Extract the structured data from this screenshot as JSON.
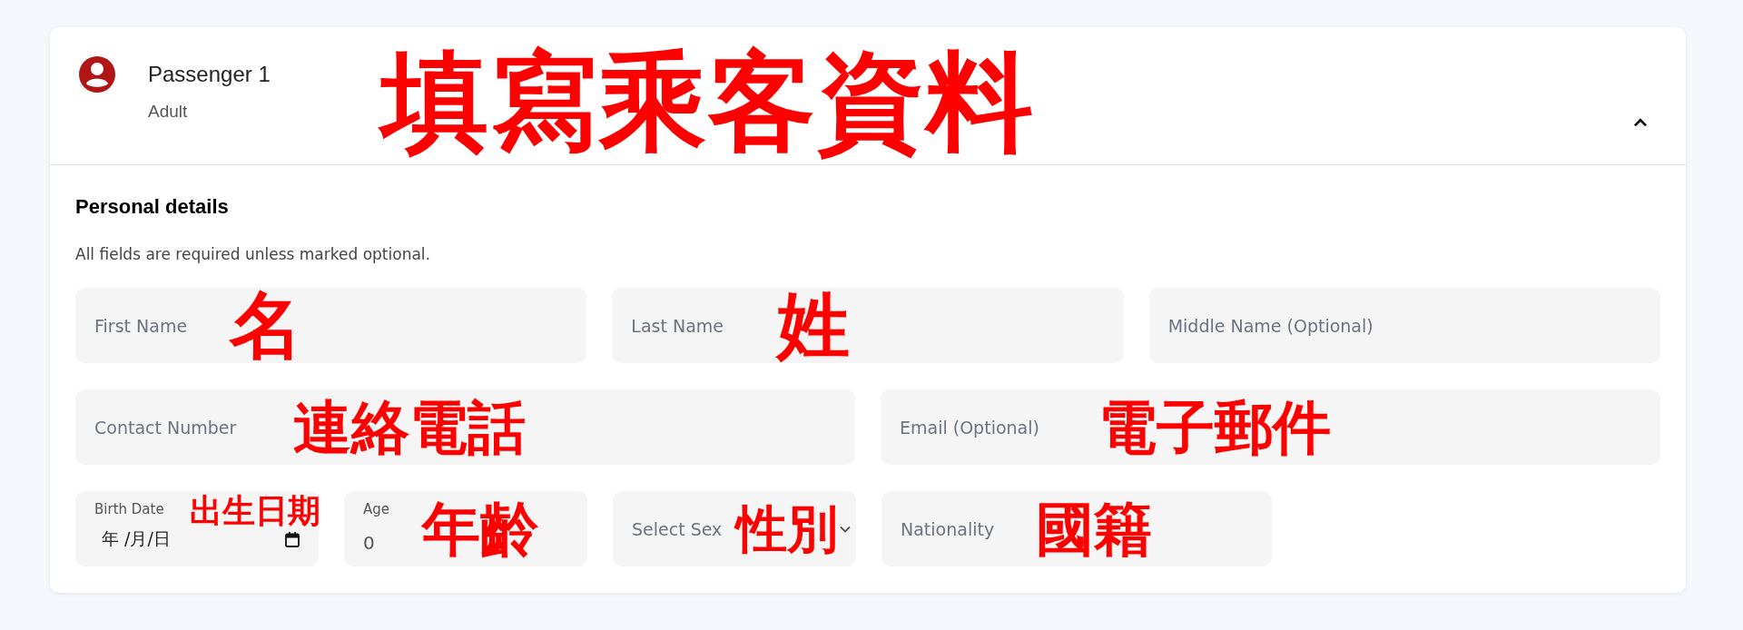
{
  "passenger": {
    "title": "Passenger 1",
    "type": "Adult",
    "expanded": true
  },
  "title_annotation": "填寫乘客資料",
  "section": {
    "heading": "Personal details",
    "note": "All fields are required unless marked optional."
  },
  "rows": [
    [
      {
        "kind": "text",
        "placeholder": "First Name",
        "annotation": "名"
      },
      {
        "kind": "text",
        "placeholder": "Last Name",
        "annotation": "姓"
      },
      {
        "kind": "text",
        "placeholder": "Middle Name (Optional)"
      }
    ],
    [
      {
        "kind": "text",
        "placeholder": "Contact Number",
        "annotation": "連絡電話"
      },
      {
        "kind": "text",
        "placeholder": "Email (Optional)",
        "annotation": "電子郵件"
      }
    ],
    [
      {
        "kind": "date",
        "label": "Birth Date",
        "value": "年 /月/日",
        "annotation": "出生日期"
      },
      {
        "kind": "number",
        "label": "Age",
        "value": "0",
        "annotation": "年齡"
      },
      {
        "kind": "select",
        "placeholder": "Select Sex",
        "annotation": "性別"
      },
      {
        "kind": "text",
        "placeholder": "Nationality",
        "annotation": "國籍"
      }
    ]
  ]
}
